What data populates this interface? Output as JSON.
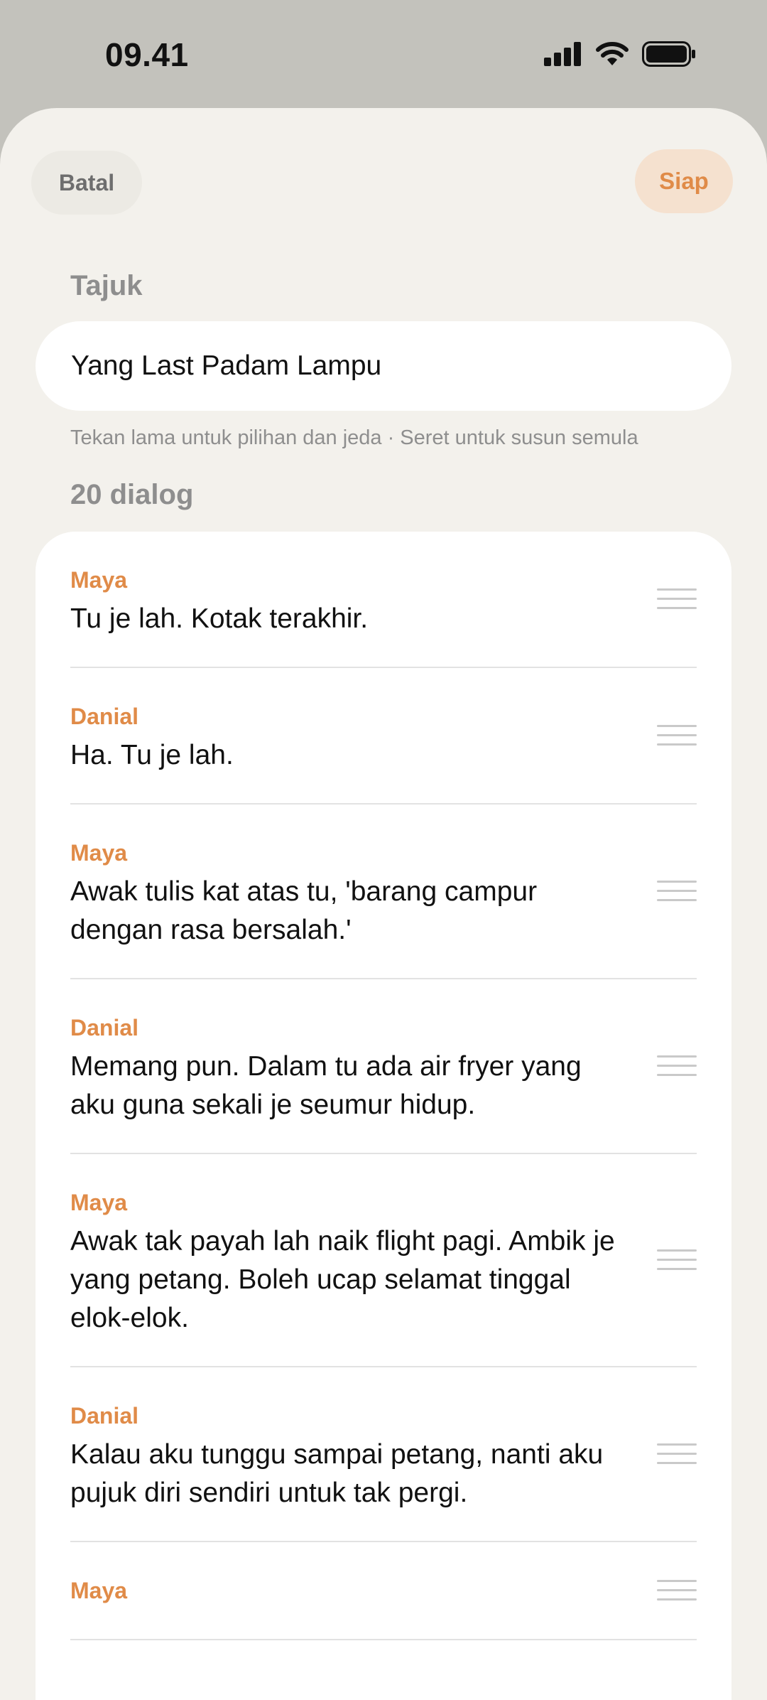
{
  "status_bar": {
    "time": "09.41"
  },
  "header": {
    "cancel_label": "Batal",
    "done_label": "Siap"
  },
  "title_section": {
    "label": "Tajuk",
    "value": "Yang Last Padam Lampu"
  },
  "hint": "Tekan lama untuk pilihan dan jeda · Seret untuk susun semula",
  "dialog_section": {
    "count_label": "20 dialog",
    "items": [
      {
        "speaker": "Maya",
        "text": "Tu je lah. Kotak terakhir."
      },
      {
        "speaker": "Danial",
        "text": "Ha. Tu je lah."
      },
      {
        "speaker": "Maya",
        "text": "Awak tulis kat atas tu, 'barang campur dengan rasa bersalah.'"
      },
      {
        "speaker": "Danial",
        "text": "Memang pun. Dalam tu ada air fryer yang aku guna sekali je seumur hidup."
      },
      {
        "speaker": "Maya",
        "text": "Awak tak payah lah naik flight pagi. Ambik je yang petang. Boleh ucap selamat tinggal elok-elok."
      },
      {
        "speaker": "Danial",
        "text": "Kalau aku tunggu sampai petang, nanti aku pujuk diri sendiri untuk tak pergi."
      },
      {
        "speaker": "Maya",
        "text": ""
      }
    ]
  },
  "colors": {
    "accent": "#E08B48",
    "sheet_background": "#F3F1EC",
    "status_background": "#C3C2BC"
  },
  "icons": {
    "signal": "cellular-signal-icon",
    "wifi": "wifi-icon",
    "battery": "battery-icon",
    "drag": "drag-handle-icon"
  }
}
